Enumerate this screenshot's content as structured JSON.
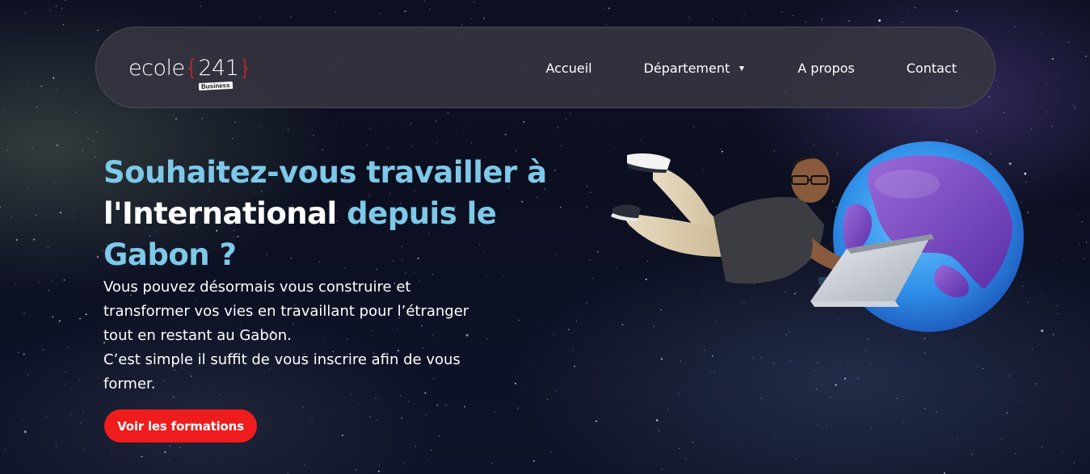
{
  "brand": {
    "logo_word": "ecole",
    "logo_brace_open": "{",
    "logo_number": "241",
    "logo_brace_close": "}",
    "logo_tag": "Business"
  },
  "nav": {
    "items": [
      {
        "label": "Accueil"
      },
      {
        "label": "Département"
      },
      {
        "label": "A propos"
      },
      {
        "label": "Contact"
      }
    ]
  },
  "hero": {
    "title_part1": "Souhaitez-vous travailler ",
    "title_part2": "à ",
    "title_part3": "l'International",
    "title_part4": " depuis le Gabon ?",
    "text_lines": [
      "Vous pouvez désormais vous construire et",
      "transformer vos vies en travaillant pour l’étranger",
      "tout en restant au Gabon.",
      "C’est simple il suffit de vous inscrire afin de vous",
      "former."
    ],
    "cta_label": "Voir les formations"
  },
  "colors": {
    "accent_blue": "#7ec8e8",
    "cta_red": "#ee1c1c",
    "logo_red": "#e8202a",
    "nav_bg": "#343440"
  }
}
